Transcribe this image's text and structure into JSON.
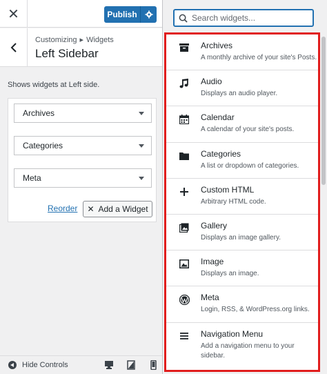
{
  "topbar": {
    "publish_label": "Publish"
  },
  "header": {
    "breadcrumb_parent": "Customizing",
    "breadcrumb_child": "Widgets",
    "breadcrumb_separator": "▸",
    "title": "Left Sidebar"
  },
  "sidebar": {
    "description": "Shows widgets at Left side.",
    "widgets": [
      {
        "label": "Archives"
      },
      {
        "label": "Categories"
      },
      {
        "label": "Meta"
      }
    ],
    "reorder_label": "Reorder",
    "add_widget_label": "Add a Widget"
  },
  "footer": {
    "hide_controls_label": "Hide Controls",
    "devices": [
      "desktop-icon",
      "tablet-icon",
      "mobile-icon"
    ]
  },
  "search": {
    "placeholder": "Search widgets..."
  },
  "available_widgets": [
    {
      "name": "Archives",
      "desc": "A monthly archive of your site's Posts.",
      "icon": "archive-icon"
    },
    {
      "name": "Audio",
      "desc": "Displays an audio player.",
      "icon": "audio-icon"
    },
    {
      "name": "Calendar",
      "desc": "A calendar of your site's posts.",
      "icon": "calendar-icon"
    },
    {
      "name": "Categories",
      "desc": "A list or dropdown of categories.",
      "icon": "folder-icon"
    },
    {
      "name": "Custom HTML",
      "desc": "Arbitrary HTML code.",
      "icon": "plus-icon"
    },
    {
      "name": "Gallery",
      "desc": "Displays an image gallery.",
      "icon": "gallery-icon"
    },
    {
      "name": "Image",
      "desc": "Displays an image.",
      "icon": "image-icon"
    },
    {
      "name": "Meta",
      "desc": "Login, RSS, & WordPress.org links.",
      "icon": "wordpress-icon"
    },
    {
      "name": "Navigation Menu",
      "desc": "Add a navigation menu to your sidebar.",
      "icon": "menu-icon"
    }
  ],
  "colors": {
    "accent": "#2271b1",
    "highlight_border": "#e11d1d",
    "panel_bg": "#f0f0f1"
  }
}
